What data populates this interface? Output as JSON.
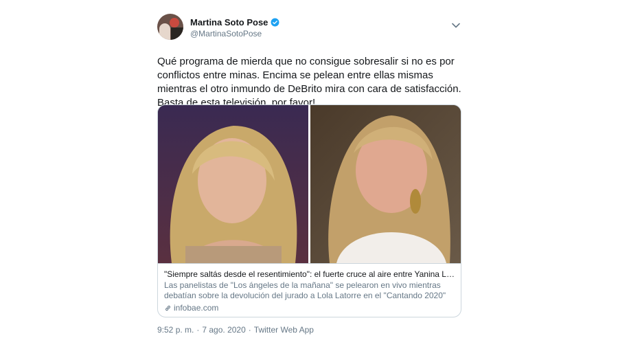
{
  "tweet": {
    "author_name": "Martina Soto Pose",
    "author_handle": "@MartinaSotoPose",
    "text": "Qué programa de mierda que no consigue sobresalir si no es por\nconflictos entre minas. Encima se pelean entre ellas mismas\nmientras el otro inmundo de DeBrito mira con cara de satisfacción.\nBasta de esta televisión, por favor!",
    "card": {
      "title": "\"Siempre saltás desde el resentimiento\": el fuerte cruce al aire entre Yanina Latorr...",
      "description": "Las panelistas de \"Los ángeles de la mañana\" se pelearon en vivo mientras debatían sobre la devolución del jurado a Lola Latorre en el \"Cantando 2020\"",
      "domain": "infobae.com"
    },
    "time": "9:52 p. m.",
    "separator": "·",
    "date": "7 ago. 2020",
    "source": "Twitter Web App"
  },
  "icons": {
    "verified": "verified-badge-icon",
    "caret": "chevron-down-icon",
    "link": "link-icon"
  },
  "colors": {
    "verified_blue": "#1da1f2",
    "secondary_text": "#657786",
    "border": "#ccd6dd"
  }
}
